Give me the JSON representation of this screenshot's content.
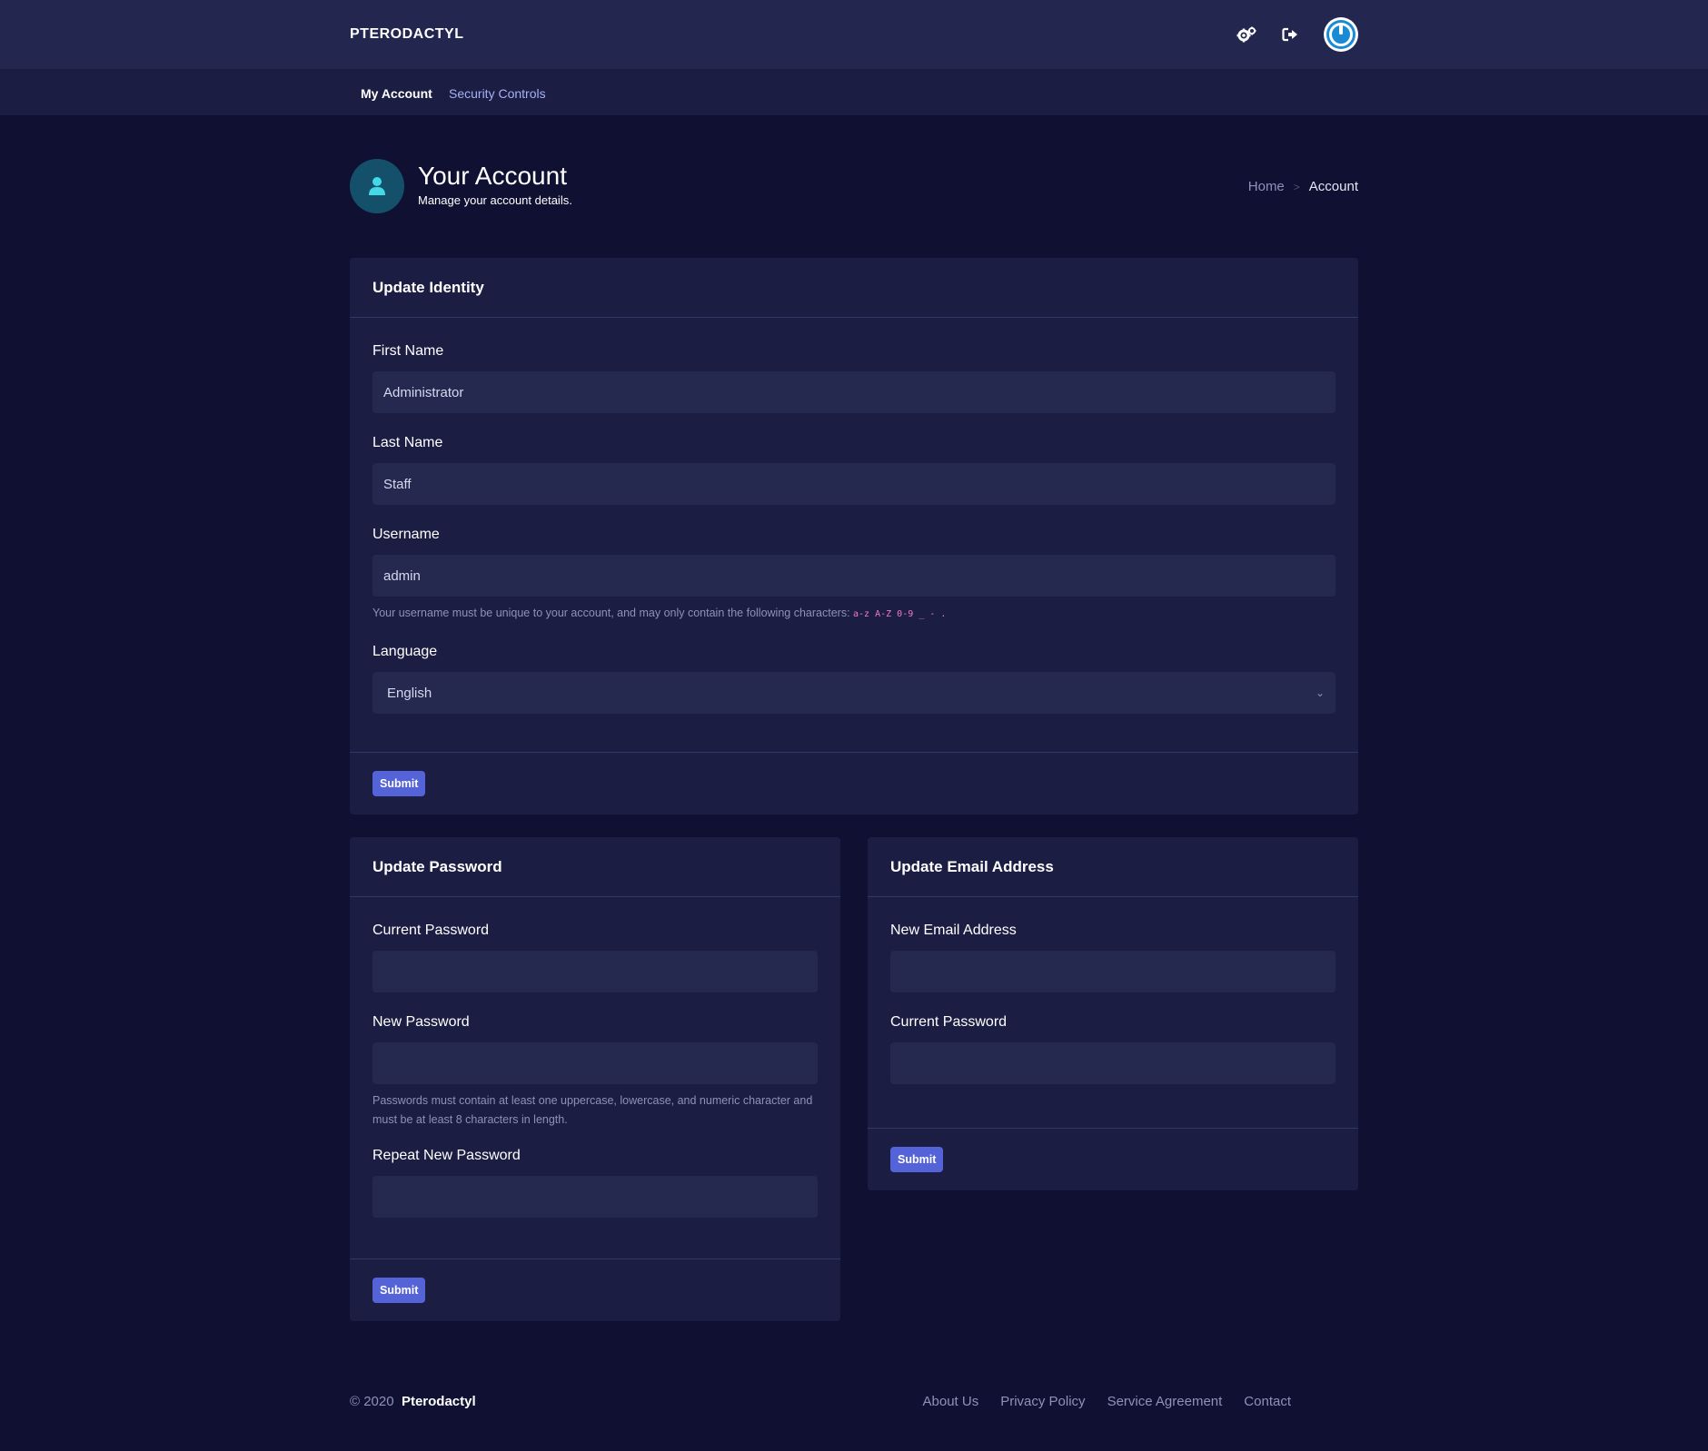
{
  "header": {
    "brand": "PTERODACTYL",
    "icons": [
      "gears-icon",
      "sign-out-icon",
      "power-icon"
    ]
  },
  "subnav": {
    "items": [
      {
        "label": "My Account",
        "active": true
      },
      {
        "label": "Security Controls",
        "active": false
      }
    ]
  },
  "page": {
    "title": "Your Account",
    "subtitle": "Manage your account details.",
    "breadcrumb": {
      "home": "Home",
      "separator": ">",
      "current": "Account"
    }
  },
  "identity": {
    "title": "Update Identity",
    "first_name_label": "First Name",
    "first_name_value": "Administrator",
    "last_name_label": "Last Name",
    "last_name_value": "Staff",
    "username_label": "Username",
    "username_value": "admin",
    "username_help": "Your username must be unique to your account, and may only contain the following characters: ",
    "username_chars": "a-z A-Z 0-9 _ - .",
    "language_label": "Language",
    "language_value": "English",
    "submit": "Submit"
  },
  "password": {
    "title": "Update Password",
    "current_label": "Current Password",
    "new_label": "New Password",
    "new_help": "Passwords must contain at least one uppercase, lowercase, and numeric character and must be at least 8 characters in length.",
    "repeat_label": "Repeat New Password",
    "submit": "Submit"
  },
  "email": {
    "title": "Update Email Address",
    "new_label": "New Email Address",
    "current_label": "Current Password",
    "submit": "Submit"
  },
  "footer": {
    "copyright": "© 2020",
    "brand": "Pterodactyl",
    "links": [
      "About Us",
      "Privacy Policy",
      "Service Agreement",
      "Contact"
    ]
  },
  "colors": {
    "background": "#0f1032",
    "topbar": "#23264e",
    "card": "#1b1d43",
    "input": "#25284f",
    "button": "#5563d8",
    "accent": "#a6b1f5"
  }
}
